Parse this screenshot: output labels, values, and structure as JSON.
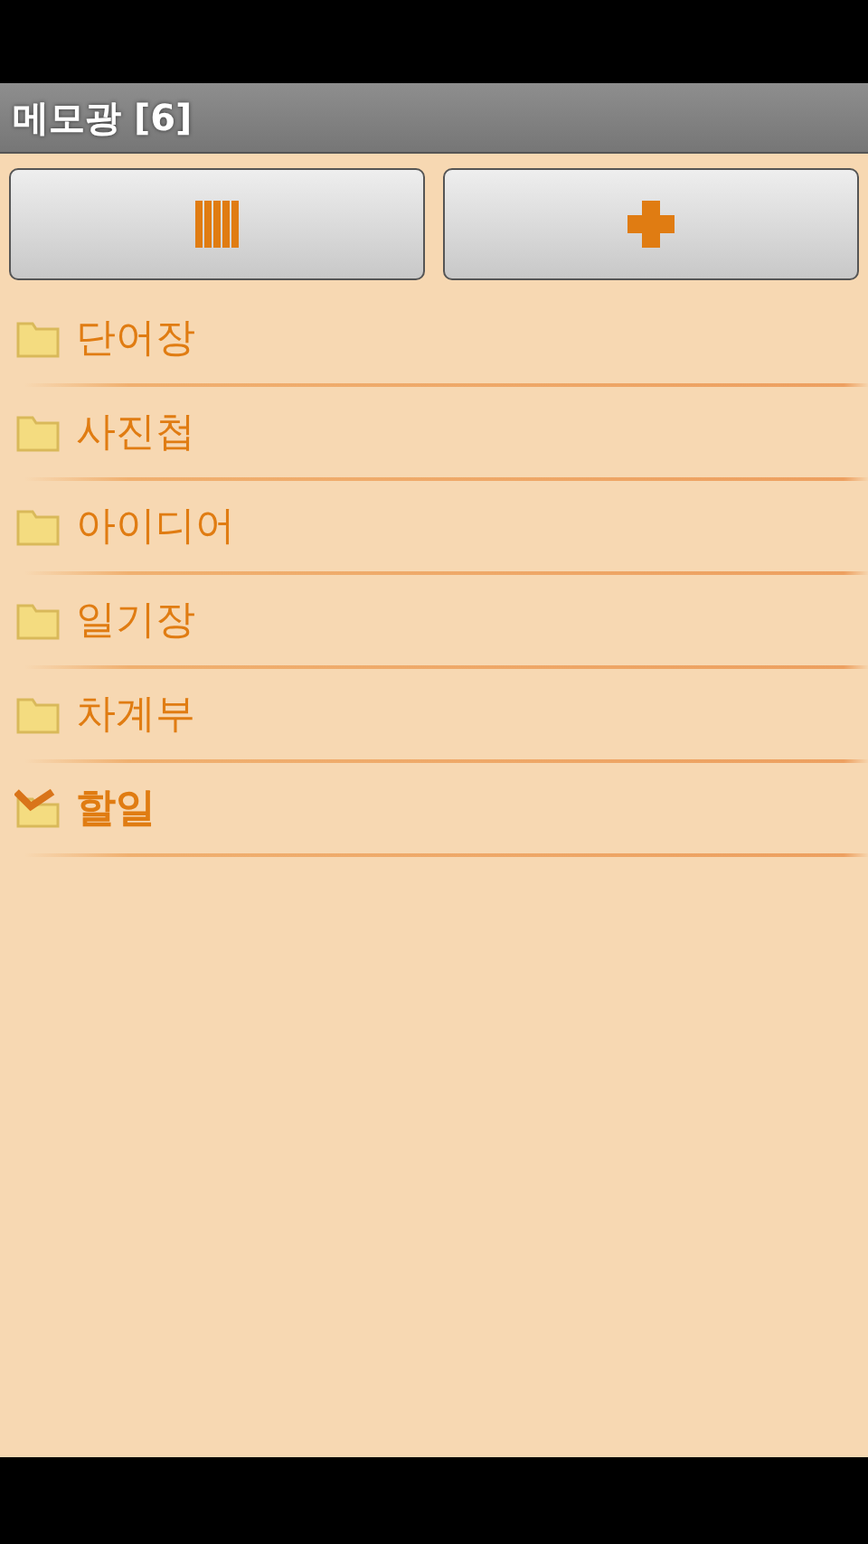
{
  "title_bar": {
    "title": "메모광 [6]"
  },
  "toolbar": {
    "buttons": [
      {
        "kind": "list"
      },
      {
        "kind": "add"
      }
    ]
  },
  "folders": [
    {
      "name": "단어장",
      "kind": "folder"
    },
    {
      "name": "사진첩",
      "kind": "folder"
    },
    {
      "name": "아이디어",
      "kind": "folder"
    },
    {
      "name": "일기장",
      "kind": "folder"
    },
    {
      "name": "차계부",
      "kind": "folder"
    },
    {
      "name": "할일",
      "kind": "todo"
    }
  ]
}
